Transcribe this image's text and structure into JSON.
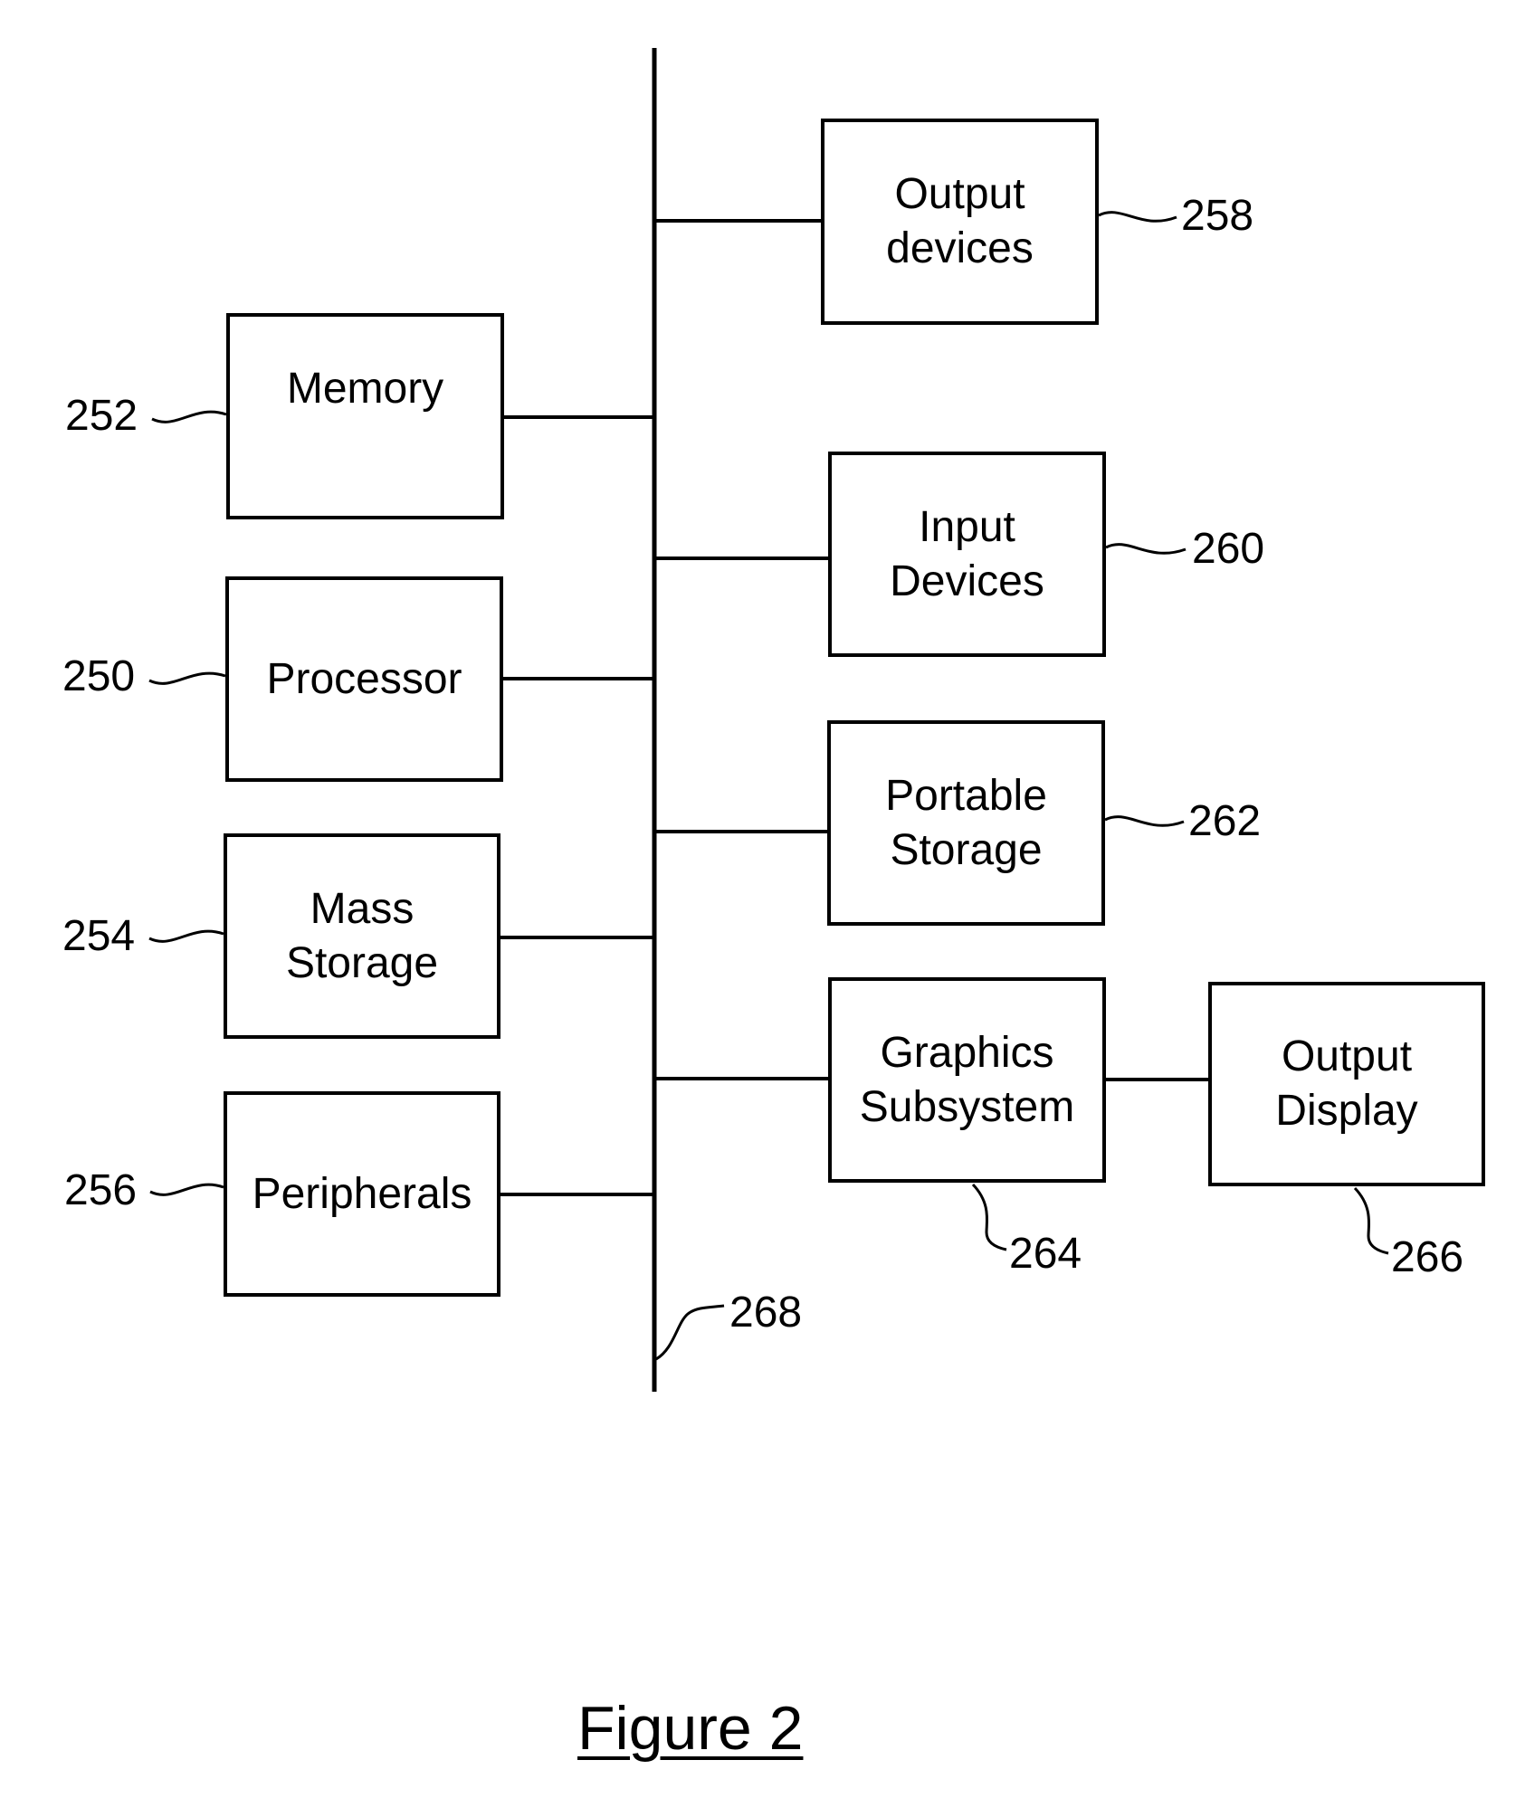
{
  "figure": {
    "caption": "Figure 2",
    "bus": {
      "ref": "268"
    },
    "components": [
      {
        "id": "output-devices",
        "label": "Output\ndevices",
        "ref": "258",
        "side": "right"
      },
      {
        "id": "memory",
        "label": "Memory",
        "ref": "252",
        "side": "left"
      },
      {
        "id": "input-devices",
        "label": "Input\nDevices",
        "ref": "260",
        "side": "right"
      },
      {
        "id": "processor",
        "label": "Processor",
        "ref": "250",
        "side": "left"
      },
      {
        "id": "portable-storage",
        "label": "Portable\nStorage",
        "ref": "262",
        "side": "right"
      },
      {
        "id": "mass-storage",
        "label": "Mass\nStorage",
        "ref": "254",
        "side": "left"
      },
      {
        "id": "graphics-subsystem",
        "label": "Graphics\nSubsystem",
        "ref": "264",
        "side": "right"
      },
      {
        "id": "output-display",
        "label": "Output\nDisplay",
        "ref": "266",
        "side": "right",
        "connected_to": "graphics-subsystem"
      },
      {
        "id": "peripherals",
        "label": "Peripherals",
        "ref": "256",
        "side": "left"
      }
    ]
  }
}
